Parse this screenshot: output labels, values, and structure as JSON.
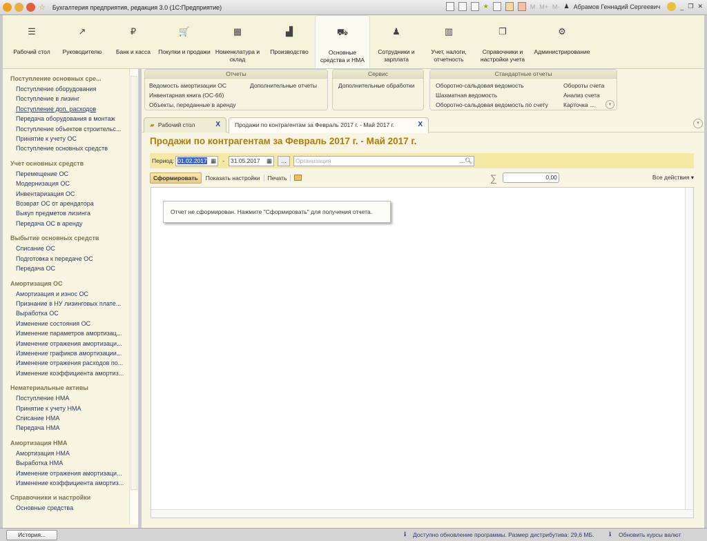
{
  "window": {
    "title": "Бухгалтерия предприятия, редакция 3.0  (1С:Предприятие)",
    "user": "Абрамов Геннадий Сергеевич",
    "m": "M",
    "mplus": "M+",
    "mminus": "M-"
  },
  "sections": [
    {
      "label": "Рабочий стол",
      "icon": "☰"
    },
    {
      "label": "Руководителю",
      "icon": "↗"
    },
    {
      "label": "Банк и касса",
      "icon": "₽"
    },
    {
      "label": "Покупки и продажи",
      "icon": "🛒"
    },
    {
      "label": "Номенклатура и склад",
      "icon": "▦"
    },
    {
      "label": "Производство",
      "icon": "▟"
    },
    {
      "label": "Основные средства и НМА",
      "icon": "⛟"
    },
    {
      "label": "Сотрудники и зарплата",
      "icon": "♟"
    },
    {
      "label": "Учет, налоги, отчетность",
      "icon": "▥"
    },
    {
      "label": "Справочники и настройки учета",
      "icon": "❐"
    },
    {
      "label": "Администрирование",
      "icon": "⚙"
    }
  ],
  "nav_groups": [
    {
      "title": "Поступление основных сре...",
      "items": [
        "Поступление оборудования",
        "Поступление в лизинг",
        "Поступление доп. расходов",
        "Передача оборудования в монтаж",
        "Поступление объектов строительс...",
        "Принятие к учету ОС",
        "Поступление основных средств"
      ]
    },
    {
      "title": "Учет основных средств",
      "items": [
        "Перемещение ОС",
        "Модернизация ОС",
        "Инвентаризация ОС",
        "Возврат ОС от арендатора",
        "Выкуп предметов лизинга",
        "Передача ОС в аренду"
      ]
    },
    {
      "title": "Выбытие основных средств",
      "items": [
        "Списание ОС",
        "Подготовка к передаче ОС",
        "Передача ОС"
      ]
    },
    {
      "title": "Амортизация ОС",
      "items": [
        "Амортизация и износ ОС",
        "Признание в НУ лизинговых плате...",
        "Выработка ОС",
        "Изменение состояния ОС",
        "Изменение параметров амортизац...",
        "Изменение отражения амортизаци...",
        "Изменение графиков амортизации...",
        "Изменение отражения расходов по...",
        "Изменение коэффициента амортиз..."
      ]
    },
    {
      "title": "Нематериальные активы",
      "items": [
        "Поступление НМА",
        "Принятие к учету НМА",
        "Списание НМА",
        "Передача НМА"
      ]
    },
    {
      "title": "Амортизация НМА",
      "items": [
        "Амортизация НМА",
        "Выработка НМА",
        "Изменение отражения амортизаци...",
        "Изменение коэффициента амортиз..."
      ]
    },
    {
      "title": "Справочники и настройки",
      "items": [
        "Основные средства"
      ]
    }
  ],
  "history_button": "История...",
  "commands": {
    "reports": {
      "title": "Отчеты",
      "items": [
        "Ведомость амортизации ОС",
        "Инвентарная книга (ОС-6б)",
        "Объекты, переданные в аренду",
        "Дополнительные отчеты"
      ]
    },
    "service": {
      "title": "Сервис",
      "items": [
        "Дополнительные обработки"
      ]
    },
    "standard": {
      "title": "Стандартные отчеты",
      "items": [
        "Оборотно-сальдовая ведомость",
        "Шахматная ведомость",
        "Оборотно-сальдовая ведомость по счету",
        "Обороты счета",
        "Анализ счета",
        "Карточка ..."
      ]
    }
  },
  "tabs": [
    {
      "label": "Рабочий стол"
    },
    {
      "label": "Продажи по контрагентам за Февраль 2017 г. - Май 2017 г."
    }
  ],
  "tab_close": "X",
  "report": {
    "title": "Продажи по контрагентам за Февраль 2017 г. - Май 2017 г.",
    "period_label": "Период:",
    "date_from": "01.02.2017",
    "dash": "-",
    "date_to": "31.05.2017",
    "dots": "...",
    "org_placeholder": "Организация",
    "generate": "Сформировать",
    "show_settings": "Показать настройки",
    "print": "Печать",
    "sum_value": "0,00",
    "all_actions": "Все действия ▾",
    "message": "Отчет не сформирован. Нажмите \"Сформировать\" для получения отчета."
  },
  "status": {
    "update": "Доступно обновление программы. Размер дистрибутива: 29,6 МБ.",
    "rates": "Обновить курсы валют"
  }
}
